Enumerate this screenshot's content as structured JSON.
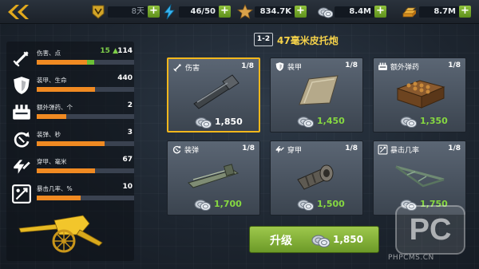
{
  "topbar": {
    "rank_value": "8天",
    "energy_value": "46/50",
    "stars_value": "834.7K",
    "silver_value": "8.4M",
    "gold_value": "8.7M",
    "plus_label": "+"
  },
  "stats": [
    {
      "name": "伤害、点",
      "value": "114",
      "bonus": "15 ▲",
      "fill": 0.52,
      "bonus_fill": 0.07,
      "icon": "shell-icon"
    },
    {
      "name": "装甲、生命",
      "value": "440",
      "fill": 0.6,
      "icon": "shield-icon"
    },
    {
      "name": "额外弹药、个",
      "value": "2",
      "fill": 0.3,
      "icon": "ammo-box-icon"
    },
    {
      "name": "装弹、秒",
      "value": "3",
      "fill": 0.7,
      "icon": "reload-icon"
    },
    {
      "name": "穿甲、毫米",
      "value": "67",
      "fill": 0.6,
      "icon": "penetration-icon"
    },
    {
      "name": "暴击几率、%",
      "value": "10",
      "fill": 0.45,
      "icon": "crit-icon"
    }
  ],
  "weapon": {
    "tier": "1-2",
    "name": "47毫米皮托炮"
  },
  "cards": [
    {
      "title": "伤害",
      "level": "1/8",
      "cost": "1,850",
      "cost_color": "white",
      "selected": true,
      "icon": "shell-icon",
      "image": "barrel-image"
    },
    {
      "title": "装甲",
      "level": "1/8",
      "cost": "1,450",
      "cost_color": "green",
      "selected": false,
      "icon": "shield-icon",
      "image": "armor-plate-image"
    },
    {
      "title": "额外弹药",
      "level": "1/8",
      "cost": "1,350",
      "cost_color": "green",
      "selected": false,
      "icon": "ammo-box-icon",
      "image": "ammo-crate-image"
    },
    {
      "title": "装弹",
      "level": "1/8",
      "cost": "1,700",
      "cost_color": "green",
      "selected": false,
      "icon": "reload-icon",
      "image": "breech-image"
    },
    {
      "title": "穿甲",
      "level": "1/8",
      "cost": "1,500",
      "cost_color": "green",
      "selected": false,
      "icon": "penetration-icon",
      "image": "muzzle-brake-image"
    },
    {
      "title": "暴击几率",
      "level": "1/8",
      "cost": "1,750",
      "cost_color": "green",
      "selected": false,
      "icon": "crit-icon",
      "image": "gun-carriage-image"
    }
  ],
  "upgrade": {
    "label": "升级",
    "cost": "1,850"
  },
  "watermark": {
    "logo": "PC",
    "url": "PHPCMS.CN"
  },
  "colors": {
    "accent_orange": "#f08a22",
    "bonus_green": "#6bbf36",
    "selected_border": "#f2b71c",
    "title_yellow": "#f5d24a",
    "button_green": "#86b43a"
  }
}
